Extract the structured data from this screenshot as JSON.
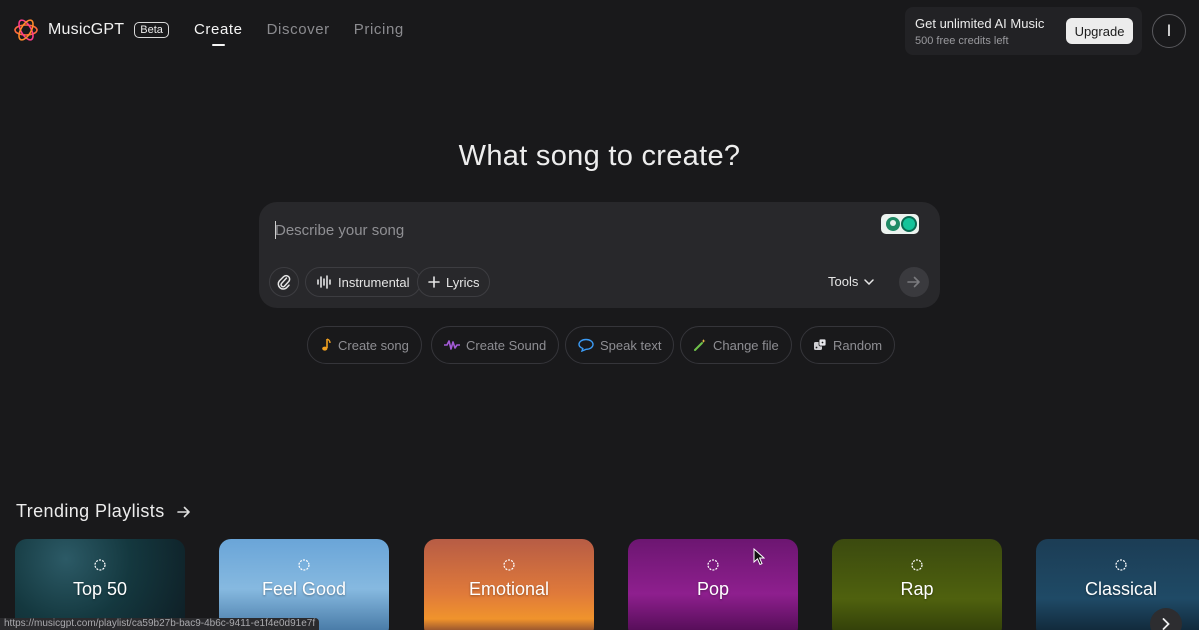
{
  "brand": {
    "name": "MusicGPT",
    "badge": "Beta",
    "logo_icon": "flower-logo-icon"
  },
  "nav": [
    {
      "label": "Create",
      "active": true
    },
    {
      "label": "Discover",
      "active": false
    },
    {
      "label": "Pricing",
      "active": false
    }
  ],
  "promo": {
    "title": "Get unlimited AI Music",
    "subtitle": "500 free credits left",
    "button": "Upgrade"
  },
  "avatar": {
    "initial": "I"
  },
  "hero": {
    "title": "What song to create?"
  },
  "prompt": {
    "placeholder": "Describe your song",
    "attach_icon": "paperclip-icon",
    "instrumental": "Instrumental",
    "lyrics": "Lyrics",
    "tools": "Tools",
    "send_icon": "arrow-right-icon"
  },
  "quick_actions": [
    {
      "label": "Create song",
      "icon": "music-note-icon"
    },
    {
      "label": "Create Sound",
      "icon": "waveform-icon"
    },
    {
      "label": "Speak text",
      "icon": "speech-bubble-icon"
    },
    {
      "label": "Change file",
      "icon": "magic-wand-icon"
    },
    {
      "label": "Random",
      "icon": "dice-icon"
    }
  ],
  "trending": {
    "title": "Trending Playlists",
    "playlists": [
      {
        "label": "Top 50"
      },
      {
        "label": "Feel Good"
      },
      {
        "label": "Emotional"
      },
      {
        "label": "Pop"
      },
      {
        "label": "Rap"
      },
      {
        "label": "Classical"
      }
    ]
  },
  "status_url": "https://musicgpt.com/playlist/ca59b27b-bac9-4b6c-9411-e1f4e0d91e7f",
  "colors": {
    "background": "#19191b",
    "surface": "#28282b",
    "accent_upgrade": "#ececec"
  }
}
